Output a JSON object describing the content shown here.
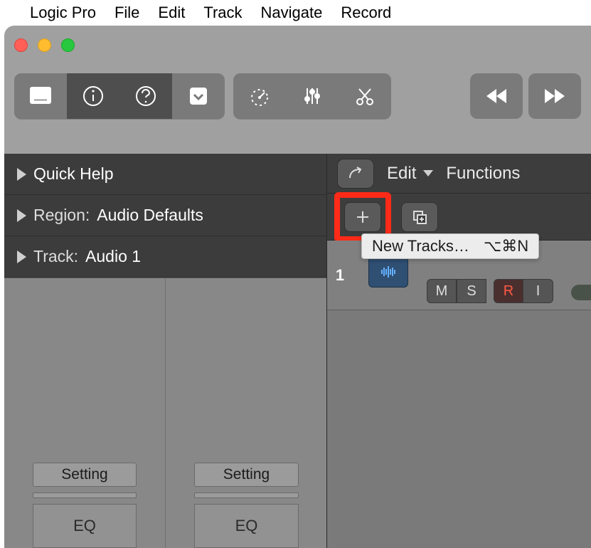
{
  "menubar": {
    "app_name": "Logic Pro",
    "items": [
      "File",
      "Edit",
      "Track",
      "Navigate",
      "Record"
    ]
  },
  "toolbar": {
    "group1": [
      "library-icon",
      "info-icon",
      "help-icon",
      "display-icon"
    ],
    "group2": [
      "tempo-icon",
      "mixer-icon",
      "scissors-icon"
    ],
    "transport": [
      "rewind-icon",
      "forward-icon"
    ]
  },
  "inspector": {
    "quick_help_label": "Quick Help",
    "region_label": "Region:",
    "region_value": "Audio Defaults",
    "track_label": "Track:",
    "track_value": "Audio 1",
    "setting_label": "Setting",
    "eq_label": "EQ"
  },
  "tracks_toolbar": {
    "edit_label": "Edit",
    "functions_label": "Functions"
  },
  "tooltip": {
    "text": "New Tracks…",
    "shortcut": "⌥⌘N"
  },
  "track": {
    "index": "1",
    "m": "M",
    "s": "S",
    "r": "R",
    "i": "I"
  }
}
